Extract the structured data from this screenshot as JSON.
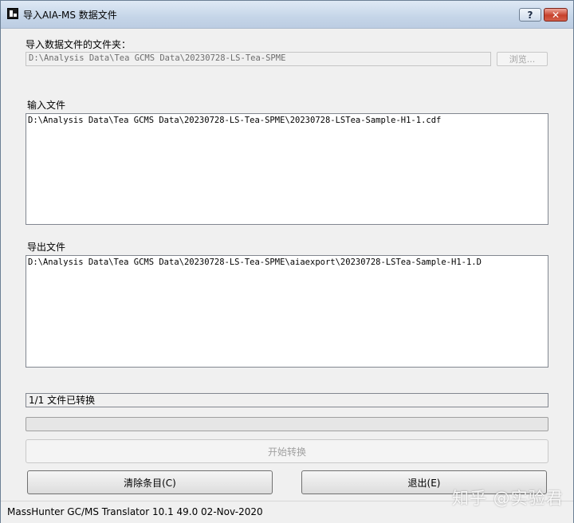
{
  "window": {
    "title": "导入AIA-MS 数据文件",
    "help_label": "?",
    "close_label": "✕"
  },
  "folder": {
    "label": "导入数据文件的文件夹：",
    "value": "D:\\Analysis Data\\Tea GCMS Data\\20230728-LS-Tea-SPME",
    "browse_label": "浏览..."
  },
  "input_files": {
    "label": "输入文件",
    "items": [
      "D:\\Analysis Data\\Tea GCMS Data\\20230728-LS-Tea-SPME\\20230728-LSTea-Sample-H1-1.cdf"
    ]
  },
  "output_files": {
    "label": "导出文件",
    "items": [
      "D:\\Analysis Data\\Tea GCMS Data\\20230728-LS-Tea-SPME\\aiaexport\\20230728-LSTea-Sample-H1-1.D"
    ]
  },
  "status": {
    "text": "1/1 文件已转换",
    "progress": 0
  },
  "buttons": {
    "start": "开始转换",
    "clear": "清除条目(C)",
    "exit": "退出(E)"
  },
  "statusbar": {
    "text": "MassHunter GC/MS Translator 10.1 49.0 02-Nov-2020"
  },
  "watermark": "知乎 @实验君"
}
